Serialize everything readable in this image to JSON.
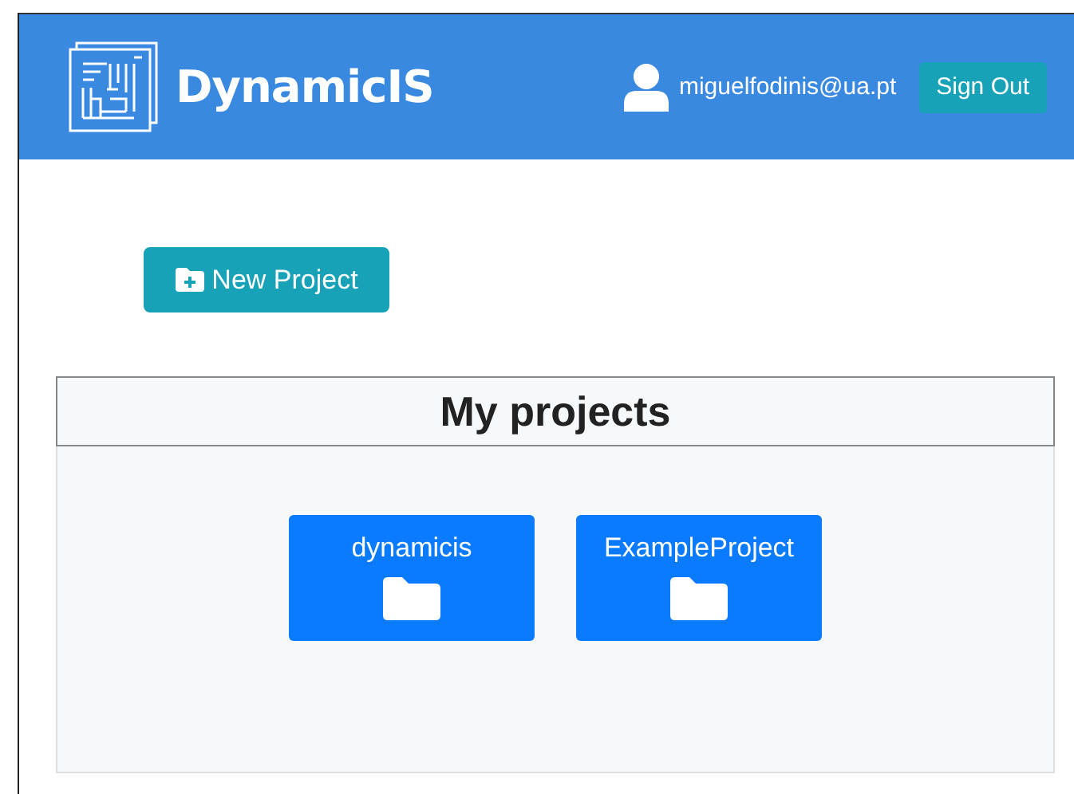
{
  "header": {
    "title": "DynamicIS",
    "user_email": "miguelfodinis@ua.pt",
    "sign_out": "Sign Out"
  },
  "new_project_button": "New Project",
  "projects_panel": {
    "title": "My projects",
    "projects": [
      {
        "name": "dynamicis"
      },
      {
        "name": "ExampleProject"
      }
    ]
  }
}
